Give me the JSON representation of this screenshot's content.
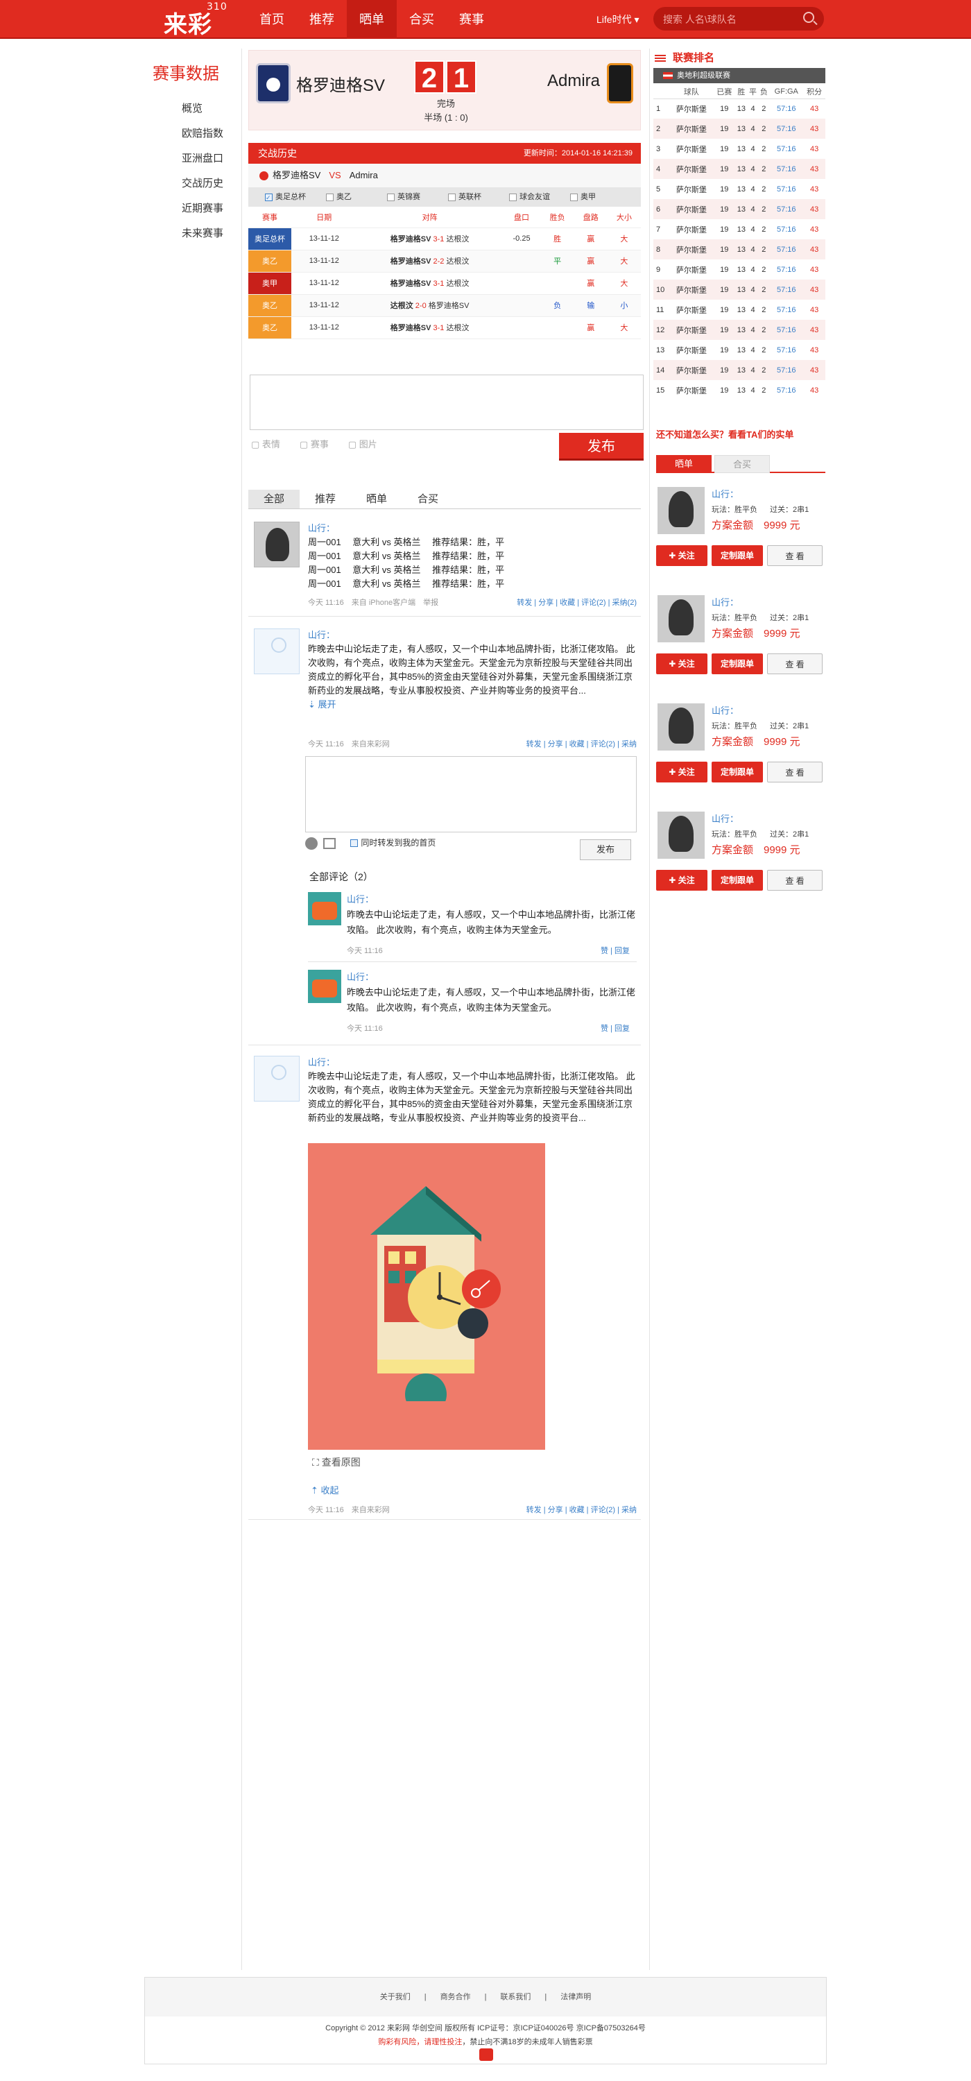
{
  "header": {
    "logo": "来彩",
    "logo_sup": "310",
    "nav": [
      "首页",
      "推荐",
      "晒单",
      "合买",
      "赛事"
    ],
    "nav_active": "晒单",
    "life": "Life时代",
    "search_placeholder": "搜索 人名\\球队名",
    "accent": "#e02b20"
  },
  "sidebar": {
    "title": "赛事数据",
    "items": [
      "概览",
      "欧赔指数",
      "亚洲盘口",
      "交战历史",
      "近期赛事",
      "未来赛事"
    ]
  },
  "match": {
    "home": "格罗迪格SV",
    "away": "Admira",
    "home_score": "2",
    "away_score": "1",
    "status": "完场",
    "half": "半场 (1 : 0)"
  },
  "history": {
    "title": "交战历史",
    "updated": "更新时间：2014-01-16 14:21:39",
    "home": "格罗迪格SV",
    "vs": "VS",
    "away": "Admira",
    "filters": [
      {
        "label": "奥足总杯",
        "checked": true
      },
      {
        "label": "奥乙",
        "checked": false
      },
      {
        "label": "英锦赛",
        "checked": false
      },
      {
        "label": "英联杯",
        "checked": false
      },
      {
        "label": "球会友谊",
        "checked": false
      },
      {
        "label": "奥甲",
        "checked": false
      }
    ],
    "headers": [
      "赛事",
      "日期",
      "对阵",
      "盘口",
      "胜负",
      "盘路",
      "大小"
    ],
    "rows": [
      {
        "league": "奥足总杯",
        "color": "#2c5aa8",
        "date": "13-11-12",
        "home": "格罗迪格SV",
        "score": "3-1",
        "away": "达根汶",
        "handicap": "-0.25",
        "result": "胜",
        "pan": "赢",
        "size": "大"
      },
      {
        "league": "奥乙",
        "color": "#f39a2c",
        "date": "13-11-12",
        "home": "格罗迪格SV",
        "score": "2-2",
        "away": "达根汶",
        "handicap": "",
        "result": "平",
        "pan": "赢",
        "size": "大"
      },
      {
        "league": "奥甲",
        "color": "#c8201a",
        "date": "13-11-12",
        "home": "格罗迪格SV",
        "score": "3-1",
        "away": "达根汶",
        "handicap": "",
        "result": "",
        "pan": "赢",
        "size": "大"
      },
      {
        "league": "奥乙",
        "color": "#f39a2c",
        "date": "13-11-12",
        "home": "达根汶",
        "score": "2-0",
        "away": "格罗迪格SV",
        "handicap": "",
        "result": "负",
        "pan": "输",
        "size": "小"
      },
      {
        "league": "奥乙",
        "color": "#f39a2c",
        "date": "13-11-12",
        "home": "格罗迪格SV",
        "score": "3-1",
        "away": "达根汶",
        "handicap": "",
        "result": "",
        "pan": "赢",
        "size": "大"
      }
    ]
  },
  "composer": {
    "tools": [
      "表情",
      "赛事",
      "图片"
    ],
    "publish": "发布"
  },
  "feed_tabs": [
    "全部",
    "推荐",
    "晒单",
    "合买"
  ],
  "posts": [
    {
      "user": "山行：",
      "lines": [
        "周一001　 意大利 vs 英格兰　 推荐结果：胜，平",
        "周一001　 意大利 vs 英格兰　 推荐结果：胜，平",
        "周一001　 意大利 vs 英格兰　 推荐结果：胜，平",
        "周一001　 意大利 vs 英格兰　 推荐结果：胜，平"
      ],
      "time": "今天 11:16",
      "source": "来自 iPhone客户端",
      "report": "举报",
      "actions": "转发 | 分享 | 收藏 | 评论(2) | 采纳(2)"
    },
    {
      "user": "山行：",
      "text": "昨晚去中山论坛走了走，有人感叹，又一个中山本地品牌扑街，比浙江佬攻陷。 此次收购，有个亮点，收购主体为天堂金元。天堂金元为京新控股与天堂硅谷共同出资成立的孵化平台，其中85%的资金由天堂硅谷对外募集，天堂元金系围绕浙江京新药业的发展战略，专业从事股权投资、产业并购等业务的投资平台...",
      "expand": "展开",
      "time": "今天 11:16",
      "source": "来自来彩网",
      "actions": "转发 | 分享 | 收藏 | 评论(2) | 采纳"
    },
    {
      "user": "山行：",
      "text": "昨晚去中山论坛走了走，有人感叹，又一个中山本地品牌扑街，比浙江佬攻陷。 此次收购，有个亮点，收购主体为天堂金元。天堂金元为京新控股与天堂硅谷共同出资成立的孵化平台，其中85%的资金由天堂硅谷对外募集，天堂元金系围绕浙江京新药业的发展战略，专业从事股权投资、产业并购等业务的投资平台...",
      "view_original": "查看原图",
      "collapse": "收起",
      "time": "今天 11:16",
      "source": "来自来彩网",
      "actions": "转发 | 分享 | 收藏 | 评论(2) | 采纳"
    }
  ],
  "comment_box": {
    "sync_label": "同时转发到我的首页",
    "publish": "发布",
    "all_label": "全部评论（2）"
  },
  "comments": [
    {
      "user": "山行：",
      "text": "昨晚去中山论坛走了走，有人感叹，又一个中山本地品牌扑街，比浙江佬攻陷。 此次收购，有个亮点，收购主体为天堂金元。",
      "time": "今天 11:16",
      "ops": "赞 | 回复"
    },
    {
      "user": "山行：",
      "text": "昨晚去中山论坛走了走，有人感叹，又一个中山本地品牌扑街，比浙江佬攻陷。 此次收购，有个亮点，收购主体为天堂金元。",
      "time": "今天 11:16",
      "ops": "赞 | 回复"
    }
  ],
  "standings": {
    "title": "联赛排名",
    "league": "奥地利超级联赛",
    "headers": [
      "球队",
      "已赛",
      "胜",
      "平",
      "负",
      "GF:GA",
      "积分"
    ],
    "rows": [
      {
        "rank": "1",
        "team": "萨尔斯堡",
        "p": "19",
        "w": "13",
        "d": "4",
        "l": "2",
        "gfga": "57:16",
        "pts": "43"
      },
      {
        "rank": "2",
        "team": "萨尔斯堡",
        "p": "19",
        "w": "13",
        "d": "4",
        "l": "2",
        "gfga": "57:16",
        "pts": "43"
      },
      {
        "rank": "3",
        "team": "萨尔斯堡",
        "p": "19",
        "w": "13",
        "d": "4",
        "l": "2",
        "gfga": "57:16",
        "pts": "43"
      },
      {
        "rank": "4",
        "team": "萨尔斯堡",
        "p": "19",
        "w": "13",
        "d": "4",
        "l": "2",
        "gfga": "57:16",
        "pts": "43"
      },
      {
        "rank": "5",
        "team": "萨尔斯堡",
        "p": "19",
        "w": "13",
        "d": "4",
        "l": "2",
        "gfga": "57:16",
        "pts": "43"
      },
      {
        "rank": "6",
        "team": "萨尔斯堡",
        "p": "19",
        "w": "13",
        "d": "4",
        "l": "2",
        "gfga": "57:16",
        "pts": "43"
      },
      {
        "rank": "7",
        "team": "萨尔斯堡",
        "p": "19",
        "w": "13",
        "d": "4",
        "l": "2",
        "gfga": "57:16",
        "pts": "43"
      },
      {
        "rank": "8",
        "team": "萨尔斯堡",
        "p": "19",
        "w": "13",
        "d": "4",
        "l": "2",
        "gfga": "57:16",
        "pts": "43"
      },
      {
        "rank": "9",
        "team": "萨尔斯堡",
        "p": "19",
        "w": "13",
        "d": "4",
        "l": "2",
        "gfga": "57:16",
        "pts": "43"
      },
      {
        "rank": "10",
        "team": "萨尔斯堡",
        "p": "19",
        "w": "13",
        "d": "4",
        "l": "2",
        "gfga": "57:16",
        "pts": "43"
      },
      {
        "rank": "11",
        "team": "萨尔斯堡",
        "p": "19",
        "w": "13",
        "d": "4",
        "l": "2",
        "gfga": "57:16",
        "pts": "43"
      },
      {
        "rank": "12",
        "team": "萨尔斯堡",
        "p": "19",
        "w": "13",
        "d": "4",
        "l": "2",
        "gfga": "57:16",
        "pts": "43"
      },
      {
        "rank": "13",
        "team": "萨尔斯堡",
        "p": "19",
        "w": "13",
        "d": "4",
        "l": "2",
        "gfga": "57:16",
        "pts": "43"
      },
      {
        "rank": "14",
        "team": "萨尔斯堡",
        "p": "19",
        "w": "13",
        "d": "4",
        "l": "2",
        "gfga": "57:16",
        "pts": "43"
      },
      {
        "rank": "15",
        "team": "萨尔斯堡",
        "p": "19",
        "w": "13",
        "d": "4",
        "l": "2",
        "gfga": "57:16",
        "pts": "43"
      }
    ]
  },
  "recommend": {
    "title": "还不知道怎么买？看看TA们的实单",
    "tabs": [
      "晒单",
      "合买"
    ],
    "cards": [
      {
        "name": "山行：",
        "play": "玩法：胜平负",
        "pass": "过关：2串1",
        "amount": "方案金额　9999 元",
        "follow": "关注",
        "custom": "定制跟单",
        "view": "查 看"
      },
      {
        "name": "山行：",
        "play": "玩法：胜平负",
        "pass": "过关：2串1",
        "amount": "方案金额　9999 元",
        "follow": "关注",
        "custom": "定制跟单",
        "view": "查 看"
      },
      {
        "name": "山行：",
        "play": "玩法：胜平负",
        "pass": "过关：2串1",
        "amount": "方案金额　9999 元",
        "follow": "关注",
        "custom": "定制跟单",
        "view": "查 看"
      },
      {
        "name": "山行：",
        "play": "玩法：胜平负",
        "pass": "过关：2串1",
        "amount": "方案金额　9999 元",
        "follow": "关注",
        "custom": "定制跟单",
        "view": "查 看"
      }
    ]
  },
  "footer": {
    "links": [
      "关于我们",
      "商务合作",
      "联系我们",
      "法律声明"
    ],
    "copyright": "Copyright © 2012 来彩网 华创空间 版权所有 ICP证号：京ICP证040026号 京ICP备07503264号",
    "warn_red": "购彩有风险，请理性投注",
    "warn": "，禁止向不满18岁的未成年人销售彩票"
  }
}
